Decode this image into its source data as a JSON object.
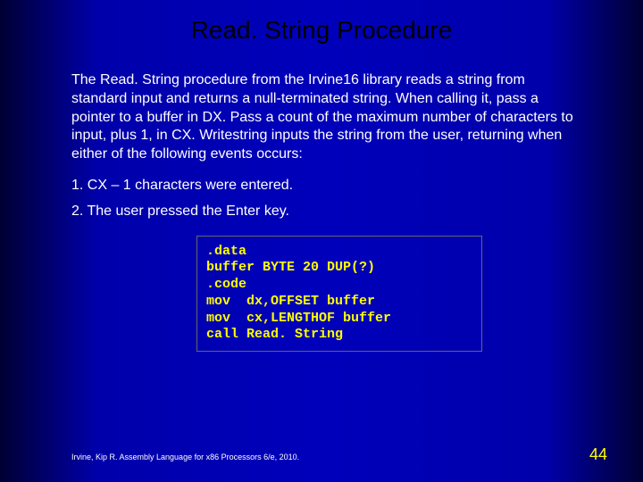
{
  "title": "Read. String Procedure",
  "paragraph": "The Read. String procedure from the Irvine16 library reads a string from standard input and returns a null-terminated string. When calling it, pass a pointer to a buffer in DX. Pass a count of the maximum number of characters to input, plus 1, in CX. Writestring inputs the string from the user, returning when either of the following events occurs:",
  "item1": "1. CX – 1 characters were entered.",
  "item2": "2. The user pressed the Enter key.",
  "code": {
    "l1": ".data",
    "l2": "buffer BYTE 20 DUP(?)",
    "l3": ".code",
    "l4": "mov  dx,OFFSET buffer",
    "l5": "mov  cx,LENGTHOF buffer",
    "l6": "call Read. String"
  },
  "citation": "Irvine, Kip R. Assembly Language for x86 Processors 6/e, 2010.",
  "page": "44"
}
